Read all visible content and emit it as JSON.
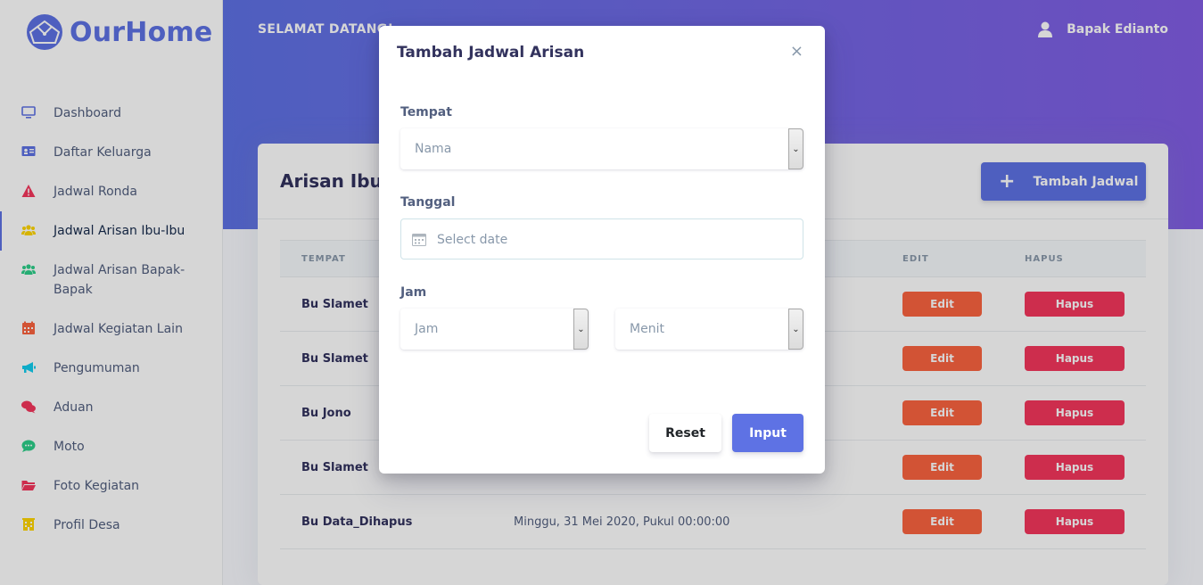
{
  "brand": {
    "name": "OurHome"
  },
  "colors": {
    "primary": "#5e72e4",
    "warning": "#fb6340",
    "danger": "#f5365c"
  },
  "sidebar": {
    "items": [
      {
        "label": "Dashboard",
        "icon": "monitor-icon",
        "color": "#5e72e4"
      },
      {
        "label": "Daftar Keluarga",
        "icon": "id-card-icon",
        "color": "#5e72e4"
      },
      {
        "label": "Jadwal Ronda",
        "icon": "warning-icon",
        "color": "#f5365c"
      },
      {
        "label": "Jadwal Arisan Ibu-Ibu",
        "icon": "users-icon",
        "color": "#ffd600"
      },
      {
        "label": "Jadwal Arisan Bapak-Bapak",
        "icon": "users-icon",
        "color": "#2dce89"
      },
      {
        "label": "Jadwal Kegiatan Lain",
        "icon": "calendar-icon",
        "color": "#fb6340"
      },
      {
        "label": "Pengumuman",
        "icon": "megaphone-icon",
        "color": "#11cdef"
      },
      {
        "label": "Aduan",
        "icon": "comments-icon",
        "color": "#f5365c"
      },
      {
        "label": "Moto",
        "icon": "chat-icon",
        "color": "#2dce89"
      },
      {
        "label": "Foto Kegiatan",
        "icon": "folder-icon",
        "color": "#f5365c"
      },
      {
        "label": "Profil Desa",
        "icon": "building-icon",
        "color": "#ffd600"
      }
    ]
  },
  "header": {
    "welcome": "SELAMAT DATANG!",
    "user": "Bapak Edianto"
  },
  "card": {
    "title": "Arisan Ibu-I",
    "add_button": "Tambah Jadwal",
    "columns": {
      "place": "TEMPAT",
      "edit": "EDIT",
      "delete": "HAPUS"
    },
    "rows": [
      {
        "place": "Bu Slamet",
        "date": ""
      },
      {
        "place": "Bu Slamet",
        "date": ""
      },
      {
        "place": "Bu Jono",
        "date": ""
      },
      {
        "place": "Bu Slamet",
        "date": ""
      },
      {
        "place": "Bu Data_Dihapus",
        "date": "Minggu, 31 Mei 2020, Pukul 00:00:00"
      }
    ],
    "edit_label": "Edit",
    "delete_label": "Hapus"
  },
  "modal": {
    "title": "Tambah Jadwal Arisan",
    "close": "×",
    "place_label": "Tempat",
    "place_value": "Nama",
    "date_label": "Tanggal",
    "date_placeholder": "Select date",
    "time_label": "Jam",
    "hour_value": "Jam",
    "minute_value": "Menit",
    "reset": "Reset",
    "submit": "Input"
  }
}
